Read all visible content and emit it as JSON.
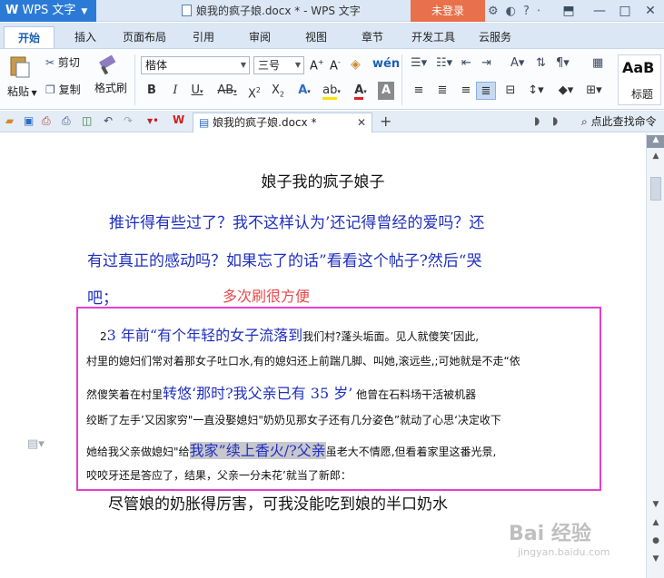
{
  "titlebar": {
    "app_name": "WPS 文字",
    "doc_title": "娘我的疯子娘.docx * - WPS 文字",
    "login": "未登录"
  },
  "tabs": [
    "开始",
    "插入",
    "页面布局",
    "引用",
    "审阅",
    "视图",
    "章节",
    "开发工具",
    "云服务"
  ],
  "ribbon": {
    "paste": "粘贴",
    "cut": "剪切",
    "copy": "复制",
    "format_painter": "格式刷",
    "font_name": "楷体",
    "font_size": "三号",
    "style_preview": "AaB",
    "style_label": "标题"
  },
  "toolbar2": {
    "doc_tab": "娘我的疯子娘.docx *",
    "search_cmd": "点此查找命令"
  },
  "document": {
    "heading": "娘子我的疯子娘子",
    "line1": "推许得有些过了？我不这样认为’还记得曾经的爱吗？还",
    "line2": "有过真正的感动吗？如果忘了的话”看看这个帖子?然后“哭",
    "line3": "吧；",
    "note": "多次刷很方便",
    "p1_small_a": "2",
    "p1_big": "3 年前“有个年轻的女子流落到",
    "p1_small_b": "我们村?蓬头垢面。见人就傻笑’因此,",
    "p2": "村里的媳妇们常对着那女子吐口水,有的媳妇还上前踹几脚、叫她,滚远些,;可她就是不走“依",
    "p3_small": "然傻笑着在村里",
    "p3_big": "转悠‘那时?我父亲已有 35 岁’",
    "p3_small_b": "他曾在石料场干活被机器",
    "p4": "绞断了左手’又因家穷\"一直没娶媳妇\"奶奶见那女子还有几分姿色”就动了心思‘决定收下",
    "p5_small": "她给我父亲做媳妇\"给",
    "p5_big": "我家”续上香火/?父亲",
    "p5_small_b": "虽老大不情愿,但看着家里这番光景,",
    "p6": "咬咬牙还是答应了，结果，父亲一分未花’就当了新郎：",
    "bottom": "尽管娘的奶胀得厉害，可我没能吃到娘的半口奶水"
  },
  "watermark": {
    "brand": "Bai 经验",
    "url": "jingyan.baidu.com"
  },
  "colors": {
    "accent": "#2b7bd6",
    "text_blue": "#1f2fbf",
    "note_red": "#e8494a",
    "box_pink": "#e23fd2",
    "login_orange": "#e8704a"
  }
}
